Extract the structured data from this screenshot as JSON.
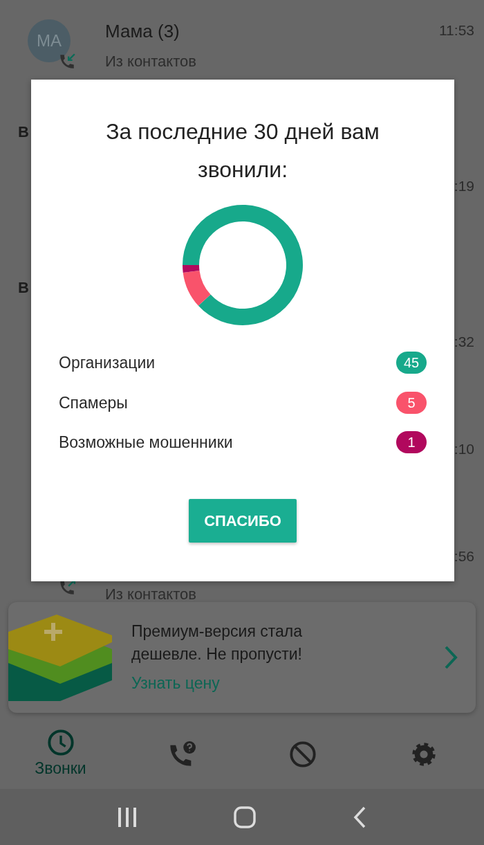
{
  "call_list": [
    {
      "kind": "call",
      "avatar": "MA",
      "name": "Мама (3)",
      "subtitle": "Из контактов",
      "time": "11:53",
      "outgoing": false
    },
    {
      "kind": "section",
      "label": "В"
    },
    {
      "kind": "call",
      "time": ":19"
    },
    {
      "kind": "section",
      "label": "В"
    },
    {
      "kind": "call",
      "time": ":32"
    },
    {
      "kind": "call",
      "time": ":10"
    },
    {
      "kind": "call",
      "time": ":56",
      "subtitle": "Из контактов",
      "outgoing": true
    }
  ],
  "dialog": {
    "title": "За последние 30 дней вам звонили:",
    "chart_data": {
      "type": "donut",
      "values": [
        88.2,
        9.8,
        2.0
      ]
    },
    "legend": [
      {
        "label": "Организации",
        "count": "45",
        "color": "#17a98b"
      },
      {
        "label": "Спамеры",
        "count": "5",
        "color": "#f9536b"
      },
      {
        "label": "Возможные мошенники",
        "count": "1",
        "color": "#b1085d"
      }
    ],
    "button": "СПАСИБО"
  },
  "promo": {
    "text": "Премиум-версия стала дешевле. Не пропусти!",
    "link": "Узнать цену"
  },
  "bottom_nav": [
    {
      "kind": "clock",
      "label": "Звонки",
      "selected": true
    },
    {
      "kind": "phone-question",
      "selected": false
    },
    {
      "kind": "block",
      "selected": false
    },
    {
      "kind": "gear",
      "selected": false
    }
  ]
}
